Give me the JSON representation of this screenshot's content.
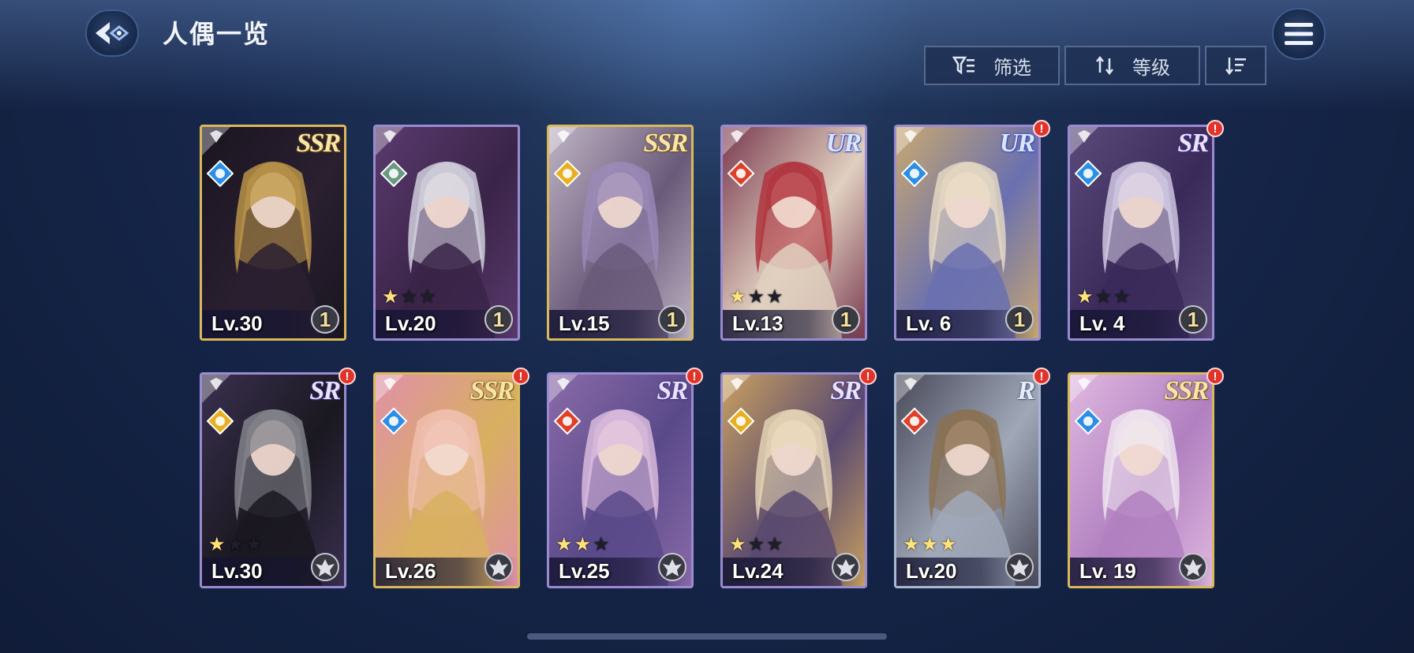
{
  "header": {
    "title": "人偶一览"
  },
  "toolbar": {
    "filter_label": "筛选",
    "sort_label": "等级"
  },
  "cards": [
    {
      "level": "Lv.30",
      "rarity": "SSR",
      "element": "water",
      "frame": "gold",
      "stars": null,
      "badge": "1",
      "alert": false,
      "palette": [
        "#1a1420",
        "#c29a4a",
        "#2a2030"
      ]
    },
    {
      "level": "Lv.20",
      "rarity": "",
      "element": "wind",
      "frame": "purple",
      "stars": "1/3",
      "badge": "1",
      "alert": false,
      "palette": [
        "#5a3a6e",
        "#d8d8e4",
        "#3a2448"
      ]
    },
    {
      "level": "Lv.15",
      "rarity": "SSR",
      "element": "light",
      "frame": "gold",
      "stars": null,
      "badge": "1",
      "alert": false,
      "palette": [
        "#bfb4c4",
        "#9a8ab8",
        "#6a5a7a"
      ]
    },
    {
      "level": "Lv.13",
      "rarity": "UR",
      "element": "fire",
      "frame": "purple",
      "stars": "1/3",
      "badge": "1",
      "alert": false,
      "palette": [
        "#7a3a50",
        "#b0303a",
        "#e0d0c0"
      ]
    },
    {
      "level": "Lv. 6",
      "rarity": "UR",
      "element": "water",
      "frame": "purple",
      "stars": null,
      "badge": "1",
      "alert": true,
      "palette": [
        "#c8a870",
        "#e8dcc4",
        "#6a70b0"
      ]
    },
    {
      "level": "Lv. 4",
      "rarity": "SR",
      "element": "water",
      "frame": "purple",
      "stars": "1/3",
      "badge": "1",
      "alert": true,
      "palette": [
        "#5a4a7a",
        "#d8d0e8",
        "#3a2a5a"
      ]
    },
    {
      "level": "Lv.30",
      "rarity": "SR",
      "element": "light",
      "frame": "purple",
      "stars": "1/3",
      "badge": "",
      "alert": true,
      "palette": [
        "#3a3050",
        "#888890",
        "#1a1820"
      ]
    },
    {
      "level": "Lv.26",
      "rarity": "SSR",
      "element": "water",
      "frame": "gold",
      "stars": null,
      "badge": "",
      "alert": true,
      "palette": [
        "#e090a8",
        "#f0c0b0",
        "#d8b060"
      ]
    },
    {
      "level": "Lv.25",
      "rarity": "SR",
      "element": "fire",
      "frame": "purple",
      "stars": "2/3",
      "badge": "",
      "alert": true,
      "palette": [
        "#8a6aa8",
        "#e0c0e0",
        "#5a4a8a"
      ]
    },
    {
      "level": "Lv.24",
      "rarity": "SR",
      "element": "light",
      "frame": "purple",
      "stars": "1/3",
      "badge": "",
      "alert": true,
      "palette": [
        "#c8a060",
        "#e8d8b8",
        "#5a4a70"
      ]
    },
    {
      "level": "Lv.20",
      "rarity": "R",
      "element": "fire",
      "frame": "silver",
      "stars": "3/3",
      "badge": "",
      "alert": true,
      "palette": [
        "#4a4a5a",
        "#8a7050",
        "#a0a8b8"
      ]
    },
    {
      "level": "Lv. 19",
      "rarity": "SSR",
      "element": "water",
      "frame": "gold",
      "stars": null,
      "badge": "",
      "alert": true,
      "palette": [
        "#e0b8e0",
        "#f0e8f0",
        "#b080c0"
      ]
    }
  ],
  "colors": {
    "accent_gold": "#d9b95a",
    "accent_purple": "#9a8bd0",
    "alert_red": "#e0342a"
  },
  "icons": {
    "back": "back-arrow-icon",
    "menu": "hamburger-menu-icon",
    "filter": "filter-icon",
    "sort": "sort-arrows-icon",
    "order": "sort-descending-icon"
  }
}
